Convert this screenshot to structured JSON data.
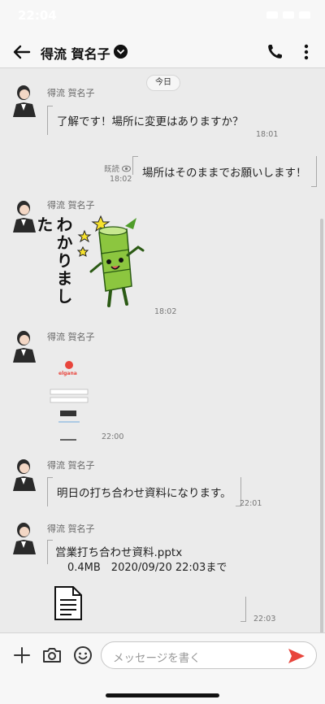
{
  "status": {
    "time": "22:04"
  },
  "header": {
    "title": "得流 賀名子"
  },
  "chat": {
    "date_label": "今日",
    "messages": [
      {
        "sender": "得流 賀名子",
        "text": "了解です！場所に変更はありますか？",
        "time": "18:01"
      },
      {
        "read": "既読",
        "text": "場所はそのままでお願いします！",
        "time": "18:02"
      },
      {
        "sender": "得流 賀名子",
        "sticker_text": "わかりました",
        "time": "18:02"
      },
      {
        "sender": "得流 賀名子",
        "preview_brand": "elgana",
        "time": "22:00"
      },
      {
        "sender": "得流 賀名子",
        "text": "明日の打ち合わせ資料になります。",
        "time": "22:01"
      },
      {
        "sender": "得流 賀名子",
        "file_name": "営業打ち合わせ資料.pptx",
        "file_meta": "0.4MB　2020/09/20 22:03まで",
        "time": "22:03"
      }
    ]
  },
  "composer": {
    "placeholder": "メッセージを書く"
  },
  "colors": {
    "accent": "#e8453c",
    "sticker_green": "#8cc63f",
    "background": "#ebebeb"
  },
  "icons": [
    "back-arrow-icon",
    "chevron-down-icon",
    "phone-icon",
    "more-icon",
    "plus-icon",
    "camera-icon",
    "emoji-icon",
    "send-icon",
    "document-icon"
  ]
}
